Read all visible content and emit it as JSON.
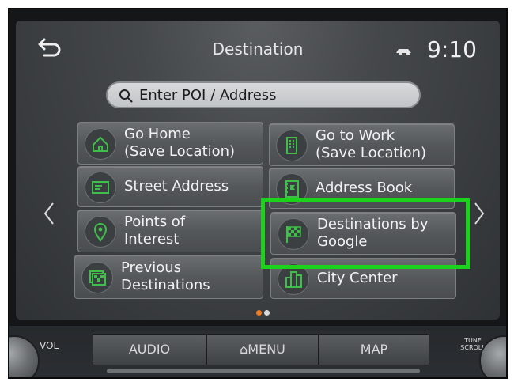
{
  "header": {
    "title": "Destination",
    "time": "9:10"
  },
  "search": {
    "placeholder": "Enter POI / Address"
  },
  "tiles": [
    {
      "label": "Go Home\n(Save Location)",
      "icon": "home-icon"
    },
    {
      "label": "Go to Work\n(Save Location)",
      "icon": "building-icon"
    },
    {
      "label": "Street Address",
      "icon": "address-card-icon"
    },
    {
      "label": "Address Book",
      "icon": "address-book-icon"
    },
    {
      "label": "Points of\nInterest",
      "icon": "map-pin-icon"
    },
    {
      "label": "Destinations by\nGoogle",
      "icon": "checkered-flag-icon"
    },
    {
      "label": "Previous\nDestinations",
      "icon": "history-flag-icon"
    },
    {
      "label": "City Center",
      "icon": "city-icon"
    }
  ],
  "pagination": {
    "current": 1,
    "total": 2
  },
  "controls": {
    "vol_label": "VOL",
    "tune_label_1": "TUNE",
    "tune_label_2": "SCROLL",
    "audio_label": "AUDIO",
    "menu_label": "MENU",
    "map_label": "MAP"
  },
  "colors": {
    "accent_green": "#3fbf4a",
    "highlight_border": "#1cd31c",
    "page_dot_active": "#f07a1e"
  }
}
